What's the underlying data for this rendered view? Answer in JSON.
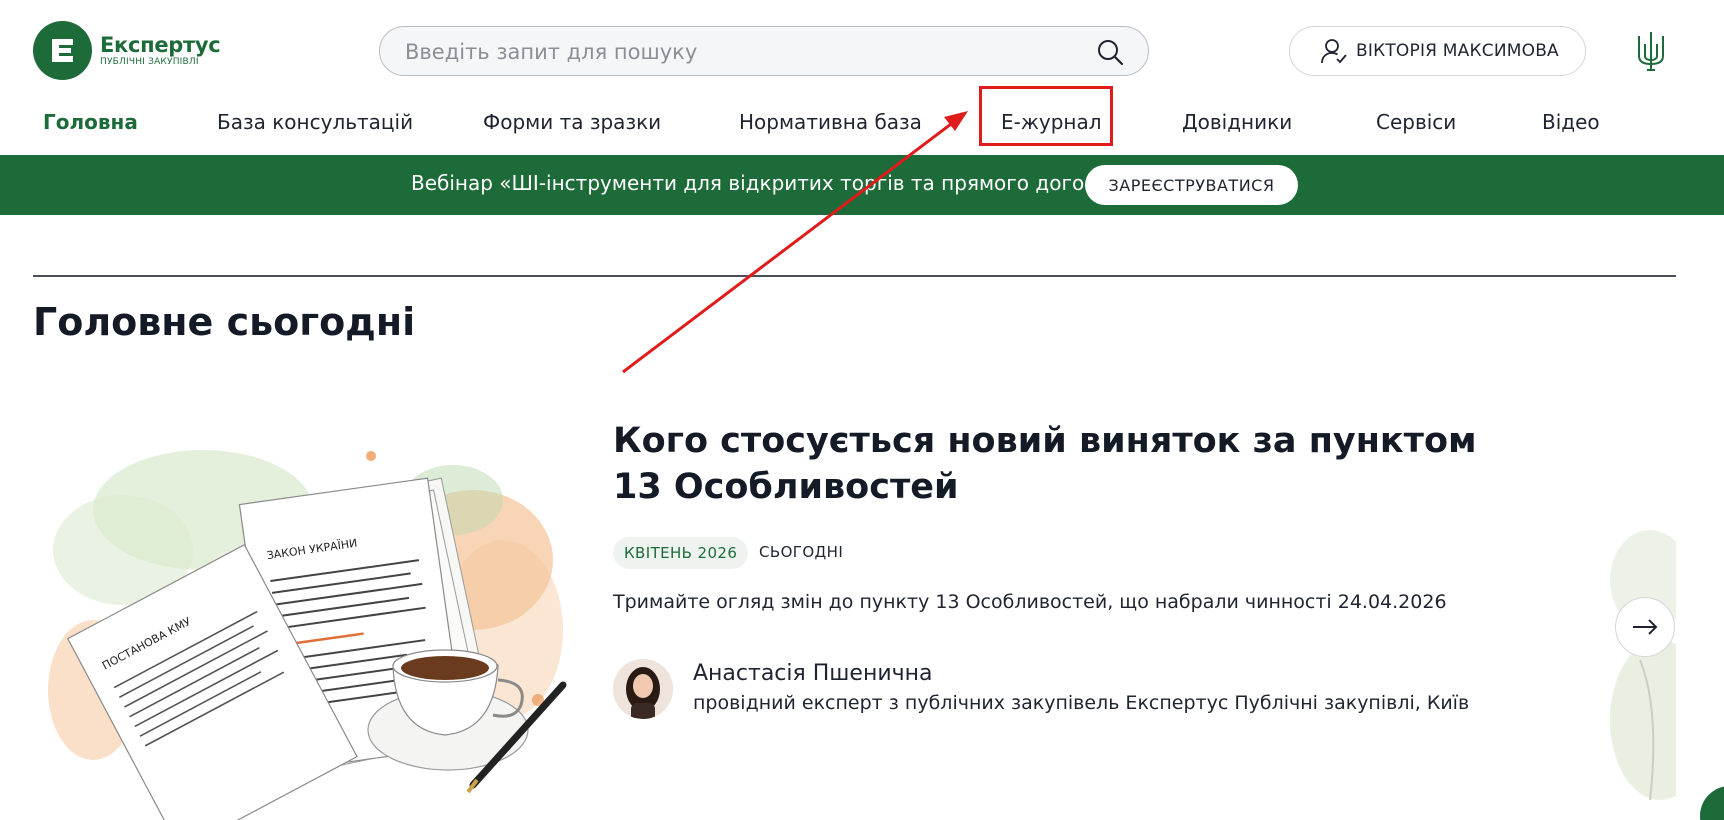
{
  "brand": {
    "name": "Експертус",
    "subtitle": "ПУБЛІЧНІ ЗАКУПІВЛІ",
    "color": "#1e6b3a"
  },
  "search": {
    "placeholder": "Введіть запит для пошуку",
    "value": ""
  },
  "user": {
    "name": "ВІКТОРІЯ МАКСИМОВА"
  },
  "nav": {
    "items": [
      {
        "label": "Головна"
      },
      {
        "label": "База консультацій"
      },
      {
        "label": "Форми та зразки"
      },
      {
        "label": "Нормативна база"
      },
      {
        "label": "Е-журнал"
      },
      {
        "label": "Довідники"
      },
      {
        "label": "Сервіси"
      },
      {
        "label": "Відео"
      }
    ],
    "active_index": 0,
    "highlighted_index": 4
  },
  "banner": {
    "text": "Вебінар «ШІ-інструменти для відкритих торгів та прямого договору»",
    "button_label": "ЗАРЕЄСТРУВАТИСЯ"
  },
  "section": {
    "title": "Головне сьогодні"
  },
  "article": {
    "title": "Кого стосується новий виняток за пунктом 13 Особливостей",
    "issue_tag": "КВІТЕНЬ 2026",
    "status_tag": "СЬОГОДНІ",
    "lead": "Тримайте огляд змін до пункту 13 Особливостей, що набрали чинності 24.04.2026",
    "author_name": "Анастасія Пшенична",
    "author_role": "провідний експерт з публічних закупівель Експертус Публічні закупівлі, Київ",
    "image_labels": {
      "doc_left": "ПОСТАНОВА КМУ",
      "doc_right": "ЗАКОН УКРАЇНИ"
    }
  },
  "annotation": {
    "color": "#e01b1b"
  }
}
